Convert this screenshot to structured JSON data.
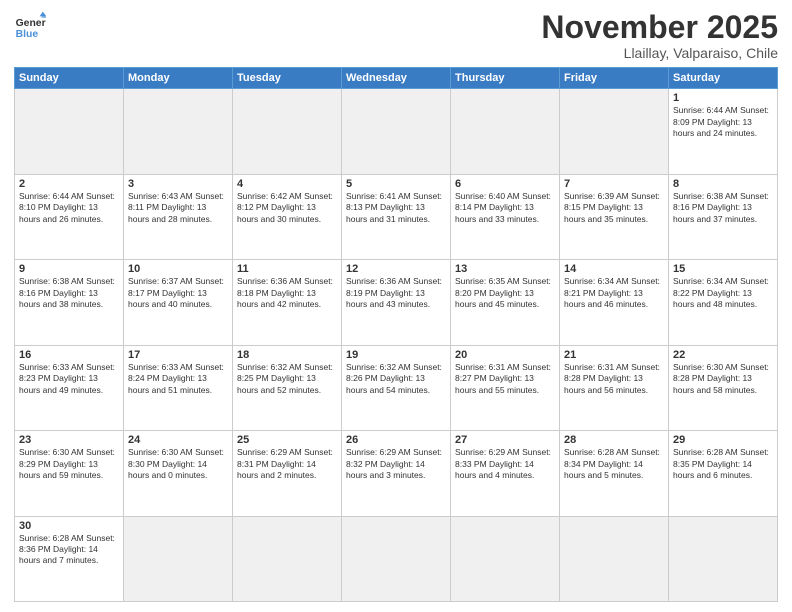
{
  "header": {
    "logo_general": "General",
    "logo_blue": "Blue",
    "month_title": "November 2025",
    "location": "Llaillay, Valparaiso, Chile"
  },
  "days_of_week": [
    "Sunday",
    "Monday",
    "Tuesday",
    "Wednesday",
    "Thursday",
    "Friday",
    "Saturday"
  ],
  "weeks": [
    [
      {
        "date": "",
        "info": "",
        "empty": true
      },
      {
        "date": "",
        "info": "",
        "empty": true
      },
      {
        "date": "",
        "info": "",
        "empty": true
      },
      {
        "date": "",
        "info": "",
        "empty": true
      },
      {
        "date": "",
        "info": "",
        "empty": true
      },
      {
        "date": "",
        "info": "",
        "empty": true
      },
      {
        "date": "1",
        "info": "Sunrise: 6:44 AM\nSunset: 8:09 PM\nDaylight: 13 hours and 24 minutes."
      }
    ],
    [
      {
        "date": "2",
        "info": "Sunrise: 6:44 AM\nSunset: 8:10 PM\nDaylight: 13 hours and 26 minutes."
      },
      {
        "date": "3",
        "info": "Sunrise: 6:43 AM\nSunset: 8:11 PM\nDaylight: 13 hours and 28 minutes."
      },
      {
        "date": "4",
        "info": "Sunrise: 6:42 AM\nSunset: 8:12 PM\nDaylight: 13 hours and 30 minutes."
      },
      {
        "date": "5",
        "info": "Sunrise: 6:41 AM\nSunset: 8:13 PM\nDaylight: 13 hours and 31 minutes."
      },
      {
        "date": "6",
        "info": "Sunrise: 6:40 AM\nSunset: 8:14 PM\nDaylight: 13 hours and 33 minutes."
      },
      {
        "date": "7",
        "info": "Sunrise: 6:39 AM\nSunset: 8:15 PM\nDaylight: 13 hours and 35 minutes."
      },
      {
        "date": "8",
        "info": "Sunrise: 6:38 AM\nSunset: 8:16 PM\nDaylight: 13 hours and 37 minutes."
      }
    ],
    [
      {
        "date": "9",
        "info": "Sunrise: 6:38 AM\nSunset: 8:16 PM\nDaylight: 13 hours and 38 minutes."
      },
      {
        "date": "10",
        "info": "Sunrise: 6:37 AM\nSunset: 8:17 PM\nDaylight: 13 hours and 40 minutes."
      },
      {
        "date": "11",
        "info": "Sunrise: 6:36 AM\nSunset: 8:18 PM\nDaylight: 13 hours and 42 minutes."
      },
      {
        "date": "12",
        "info": "Sunrise: 6:36 AM\nSunset: 8:19 PM\nDaylight: 13 hours and 43 minutes."
      },
      {
        "date": "13",
        "info": "Sunrise: 6:35 AM\nSunset: 8:20 PM\nDaylight: 13 hours and 45 minutes."
      },
      {
        "date": "14",
        "info": "Sunrise: 6:34 AM\nSunset: 8:21 PM\nDaylight: 13 hours and 46 minutes."
      },
      {
        "date": "15",
        "info": "Sunrise: 6:34 AM\nSunset: 8:22 PM\nDaylight: 13 hours and 48 minutes."
      }
    ],
    [
      {
        "date": "16",
        "info": "Sunrise: 6:33 AM\nSunset: 8:23 PM\nDaylight: 13 hours and 49 minutes."
      },
      {
        "date": "17",
        "info": "Sunrise: 6:33 AM\nSunset: 8:24 PM\nDaylight: 13 hours and 51 minutes."
      },
      {
        "date": "18",
        "info": "Sunrise: 6:32 AM\nSunset: 8:25 PM\nDaylight: 13 hours and 52 minutes."
      },
      {
        "date": "19",
        "info": "Sunrise: 6:32 AM\nSunset: 8:26 PM\nDaylight: 13 hours and 54 minutes."
      },
      {
        "date": "20",
        "info": "Sunrise: 6:31 AM\nSunset: 8:27 PM\nDaylight: 13 hours and 55 minutes."
      },
      {
        "date": "21",
        "info": "Sunrise: 6:31 AM\nSunset: 8:28 PM\nDaylight: 13 hours and 56 minutes."
      },
      {
        "date": "22",
        "info": "Sunrise: 6:30 AM\nSunset: 8:28 PM\nDaylight: 13 hours and 58 minutes."
      }
    ],
    [
      {
        "date": "23",
        "info": "Sunrise: 6:30 AM\nSunset: 8:29 PM\nDaylight: 13 hours and 59 minutes."
      },
      {
        "date": "24",
        "info": "Sunrise: 6:30 AM\nSunset: 8:30 PM\nDaylight: 14 hours and 0 minutes."
      },
      {
        "date": "25",
        "info": "Sunrise: 6:29 AM\nSunset: 8:31 PM\nDaylight: 14 hours and 2 minutes."
      },
      {
        "date": "26",
        "info": "Sunrise: 6:29 AM\nSunset: 8:32 PM\nDaylight: 14 hours and 3 minutes."
      },
      {
        "date": "27",
        "info": "Sunrise: 6:29 AM\nSunset: 8:33 PM\nDaylight: 14 hours and 4 minutes."
      },
      {
        "date": "28",
        "info": "Sunrise: 6:28 AM\nSunset: 8:34 PM\nDaylight: 14 hours and 5 minutes."
      },
      {
        "date": "29",
        "info": "Sunrise: 6:28 AM\nSunset: 8:35 PM\nDaylight: 14 hours and 6 minutes."
      }
    ],
    [
      {
        "date": "30",
        "info": "Sunrise: 6:28 AM\nSunset: 8:36 PM\nDaylight: 14 hours and 7 minutes."
      },
      {
        "date": "",
        "info": "",
        "empty": true
      },
      {
        "date": "",
        "info": "",
        "empty": true
      },
      {
        "date": "",
        "info": "",
        "empty": true
      },
      {
        "date": "",
        "info": "",
        "empty": true
      },
      {
        "date": "",
        "info": "",
        "empty": true
      },
      {
        "date": "",
        "info": "",
        "empty": true
      }
    ]
  ]
}
